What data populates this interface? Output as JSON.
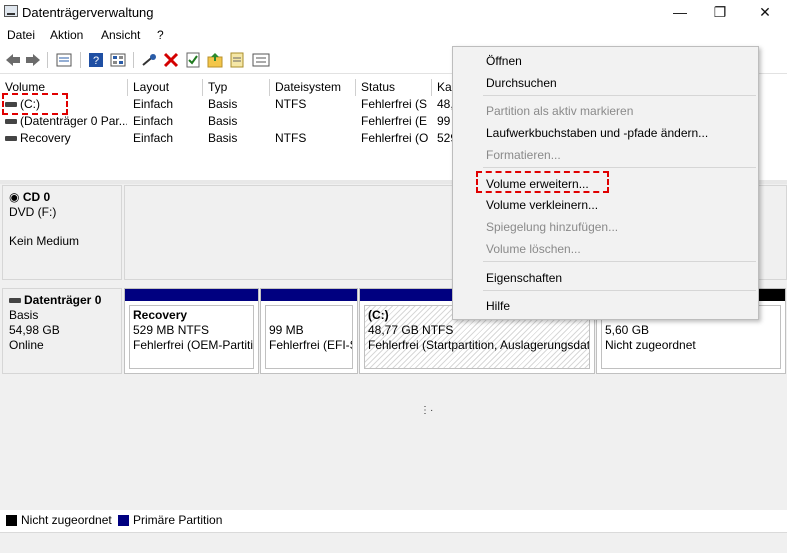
{
  "window": {
    "title": "Datenträgerverwaltung",
    "minimize": "—",
    "restore": "❐",
    "close": "✕"
  },
  "menu": [
    {
      "label": "Datei"
    },
    {
      "label": "Aktion"
    },
    {
      "label": "Ansicht"
    },
    {
      "label": "?"
    }
  ],
  "toolbar": {
    "icons": [
      "back-arrow-icon",
      "forward-arrow-icon",
      "disk-list-icon",
      "help-icon",
      "properties-grid-icon",
      "connect-icon",
      "delete-icon",
      "check-document-icon",
      "folder-up-icon",
      "view-list-icon"
    ],
    "delete_color": "#d40000"
  },
  "volume_list": {
    "columns": [
      "Volume",
      "Layout",
      "Typ",
      "Dateisystem",
      "Status",
      "Ka"
    ],
    "rows": [
      {
        "volume": "(C:)",
        "layout": "Einfach",
        "typ": "Basis",
        "dateisystem": "NTFS",
        "status": "Fehlerfrei (S",
        "kapazitaet": "48,"
      },
      {
        "volume": "(Datenträger 0 Par...",
        "layout": "Einfach",
        "typ": "Basis",
        "dateisystem": "",
        "status": "Fehlerfrei (E",
        "kapazitaet": "99"
      },
      {
        "volume": "Recovery",
        "layout": "Einfach",
        "typ": "Basis",
        "dateisystem": "NTFS",
        "status": "Fehlerfrei (O",
        "kapazitaet": "529"
      }
    ]
  },
  "cd_drive": {
    "name": "CD 0",
    "line2": "DVD (F:)",
    "line3": "Kein Medium"
  },
  "disk0": {
    "name": "Datenträger 0",
    "type": "Basis",
    "size": "54,98 GB",
    "state": "Online",
    "partitions": [
      {
        "title": "Recovery",
        "size": "529 MB NTFS",
        "status": "Fehlerfrei (OEM-Partition)"
      },
      {
        "title": "",
        "size": "99 MB",
        "status": "Fehlerfrei (EFI-Systempartition)"
      },
      {
        "title": "(C:)",
        "size": "48,77 GB NTFS",
        "status": "Fehlerfrei (Startpartition, Auslagerungsdatei)"
      },
      {
        "title": "",
        "size": "5,60 GB",
        "status": "Nicht zugeordnet"
      }
    ]
  },
  "legend": {
    "unallocated": "Nicht zugeordnet",
    "primary": "Primäre Partition",
    "unallocated_color": "#000000",
    "primary_color": "#000080"
  },
  "context_menu": {
    "items": [
      {
        "label": "Öffnen",
        "disabled": false
      },
      {
        "label": "Durchsuchen",
        "disabled": false
      },
      {
        "label": "Partition als aktiv markieren",
        "disabled": true
      },
      {
        "label": "Laufwerkbuchstaben und -pfade ändern...",
        "disabled": false
      },
      {
        "label": "Formatieren...",
        "disabled": true
      },
      {
        "label": "Volume erweitern...",
        "disabled": false
      },
      {
        "label": "Volume verkleinern...",
        "disabled": false
      },
      {
        "label": "Spiegelung hinzufügen...",
        "disabled": true
      },
      {
        "label": "Volume löschen...",
        "disabled": true
      },
      {
        "label": "Eigenschaften",
        "disabled": false
      },
      {
        "label": "Hilfe",
        "disabled": false
      }
    ]
  },
  "highlight_color": "#e00000"
}
